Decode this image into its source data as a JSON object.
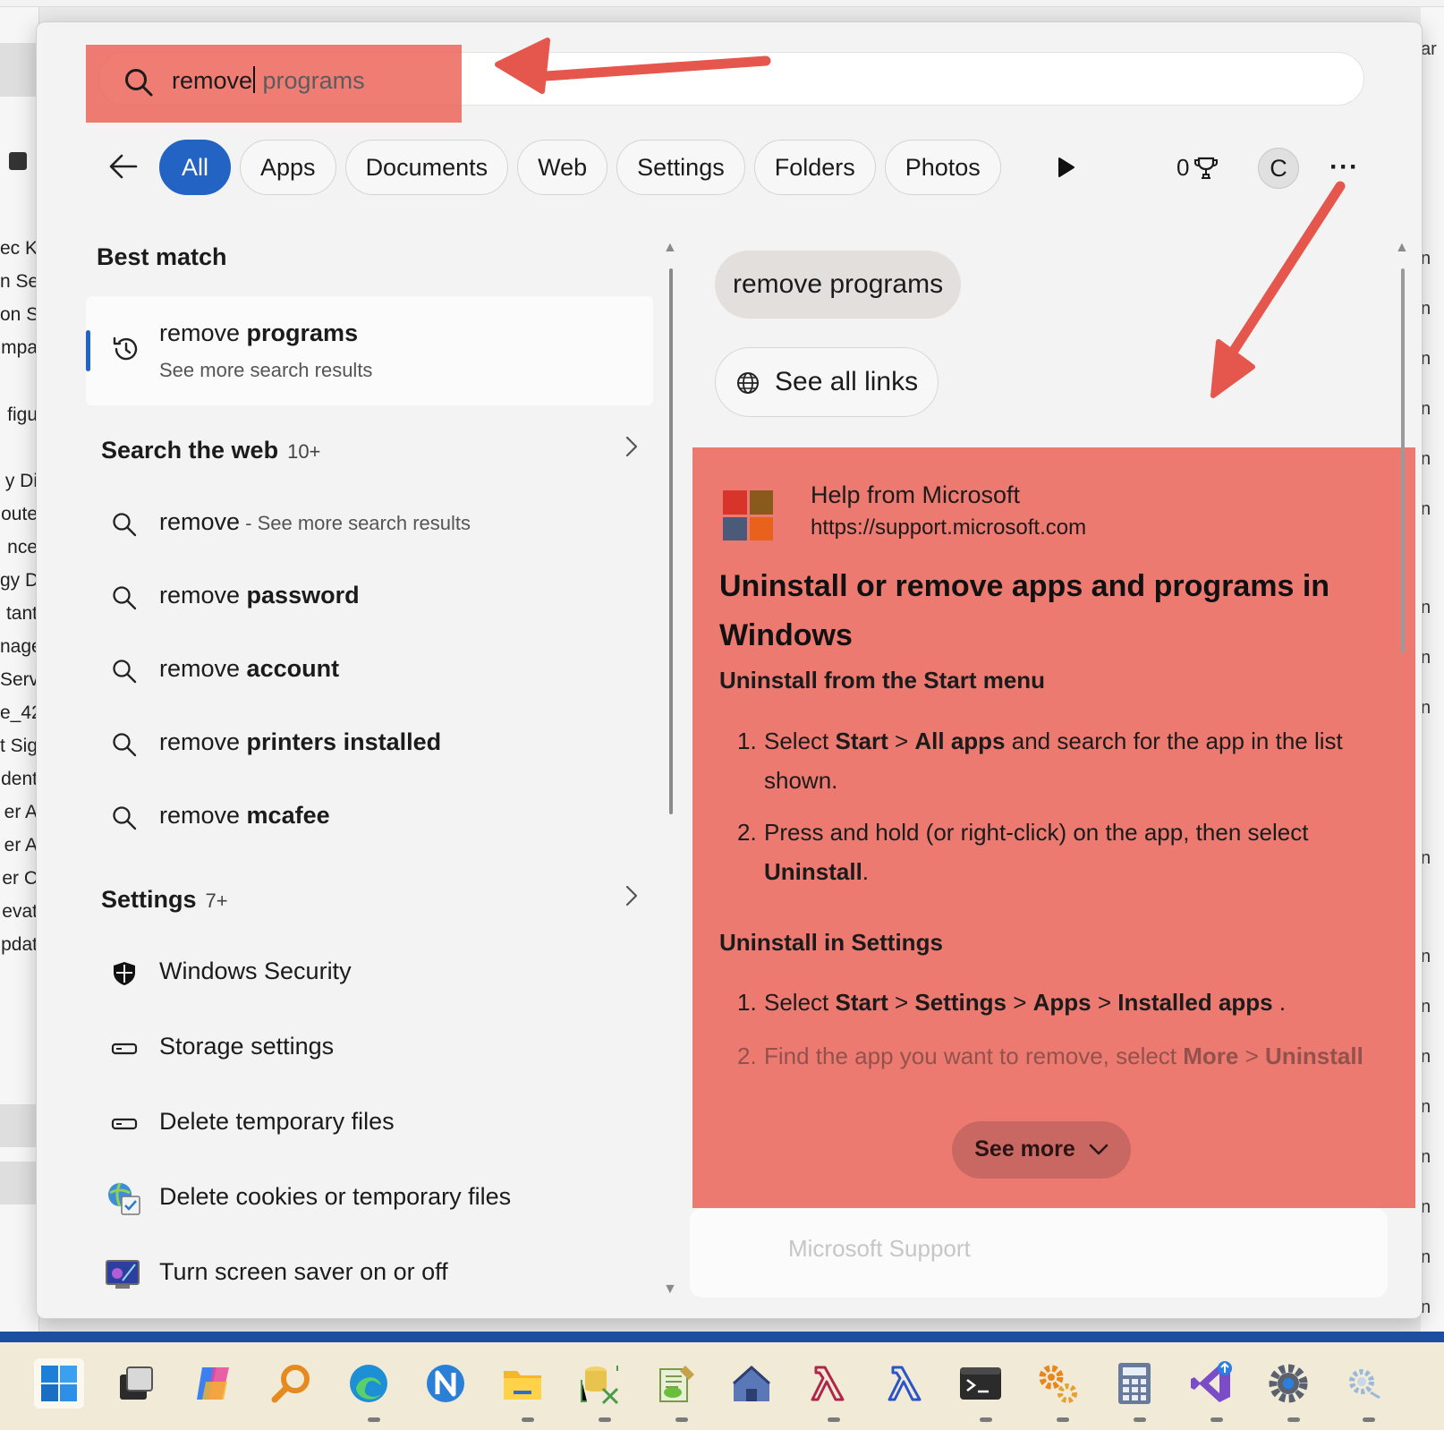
{
  "background": {
    "left_fragments": [
      "ec K",
      "n Se",
      "on S",
      "mpa",
      "figu",
      "y Di",
      "oute",
      "nce",
      "gy D",
      "tant",
      "nage",
      "Serv",
      "e_42",
      "t Sig",
      "dent",
      "er A",
      "er A",
      "er C",
      "evat",
      "pdat"
    ],
    "right_fragments": [
      "ar",
      "n",
      "n",
      "n",
      "n",
      "n",
      "n",
      "n",
      "n",
      "n",
      "n",
      "n",
      "n",
      "n",
      "n",
      "n",
      "n",
      "n",
      "n"
    ]
  },
  "search": {
    "typed": "remove",
    "suggestion": " programs"
  },
  "tabs": [
    "All",
    "Apps",
    "Documents",
    "Web",
    "Settings",
    "Folders",
    "Photos"
  ],
  "header": {
    "points": "0",
    "avatar_letter": "C",
    "more": "···"
  },
  "best_match": {
    "heading": "Best match",
    "title_plain": "remove ",
    "title_bold": "programs",
    "subtitle": "See more search results"
  },
  "web": {
    "heading": "Search the web",
    "count": "10+",
    "items": [
      {
        "plain": "remove",
        "bold": "",
        "extra": " - See more search results"
      },
      {
        "plain": "remove ",
        "bold": "password",
        "extra": ""
      },
      {
        "plain": "remove ",
        "bold": "account",
        "extra": ""
      },
      {
        "plain": "remove ",
        "bold": "printers installed",
        "extra": ""
      },
      {
        "plain": "remove ",
        "bold": "mcafee",
        "extra": ""
      }
    ]
  },
  "settings": {
    "heading": "Settings",
    "count": "7+",
    "items": [
      "Windows Security",
      "Storage settings",
      "Delete temporary files",
      "Delete cookies or temporary files",
      "Turn screen saver on or off"
    ]
  },
  "right": {
    "query_pill": "remove programs",
    "see_all_links": "See all links",
    "card": {
      "source": "Help from Microsoft",
      "url": "https://support.microsoft.com",
      "title": "Uninstall or remove apps and programs in Windows",
      "section1": "Uninstall from the Start menu",
      "s1_step1": {
        "num": "1.",
        "p1": "Select ",
        "b1": "Start",
        "p2": " > ",
        "b2": "All apps",
        "p3": " and search for the app in the list shown."
      },
      "s1_step2": {
        "num": "2.",
        "p1": "Press and hold (or right-click) on the app, then select ",
        "b1": "Uninstall",
        "p2": "."
      },
      "section2": "Uninstall in Settings",
      "s2_step1": {
        "num": "1.",
        "p1": "Select ",
        "b1": "Start",
        "p2": " > ",
        "b2": "Settings",
        "p3": " > ",
        "b3": "Apps",
        "p4": " > ",
        "b4": "Installed apps",
        "p5": " ."
      },
      "s2_step2": {
        "num": "2.",
        "p1": "Find the app you want to remove, select ",
        "b1": "More",
        "p2": " > ",
        "b2": "Uninstall"
      },
      "see_more": "See more",
      "logo_colors": [
        "#d8352a",
        "#8a5a1c",
        "#4a5a78",
        "#e8621e"
      ]
    },
    "card2_source": "Microsoft Support"
  },
  "colors": {
    "accent": "#2263c4",
    "highlight": "#ec6056",
    "arrow": "#e5574d"
  },
  "taskbar": {
    "icons": [
      "windows-start-icon",
      "task-view-icon",
      "copilot-icon",
      "search-magnifier-icon",
      "edge-icon",
      "nitro-icon",
      "file-explorer-icon",
      "database-tools-icon",
      "notepad-plus-icon",
      "home-app-icon",
      "lambda-red-icon",
      "lambda-blue-icon",
      "terminal-icon",
      "gears-icon",
      "calculator-icon",
      "visual-studio-icon",
      "settings-icon",
      "network-gear-icon"
    ]
  }
}
